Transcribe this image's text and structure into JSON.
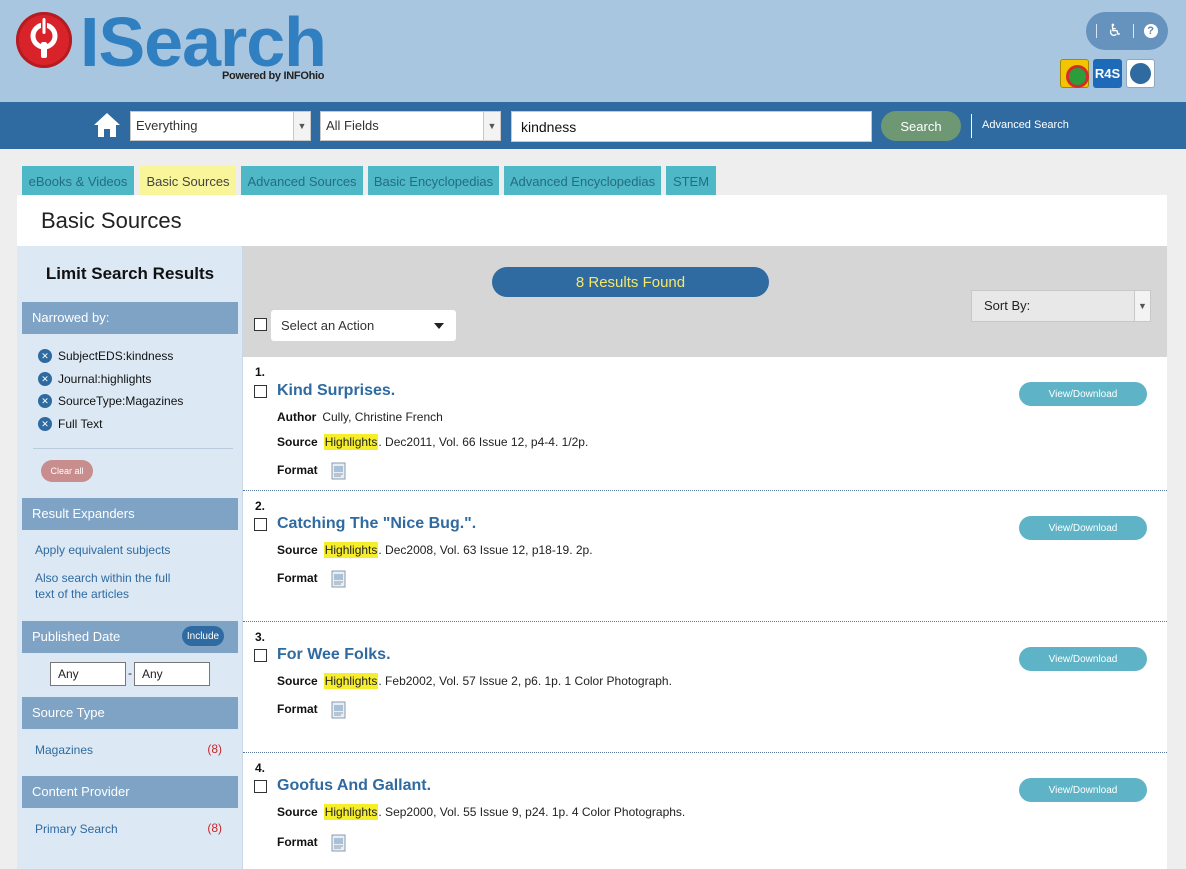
{
  "header": {
    "logo_text": "ISearch",
    "powered_by": "Powered by INFOhio",
    "help_label": "?"
  },
  "apps": {
    "app2_label": "R4S"
  },
  "search": {
    "scope": "Everything",
    "field": "All Fields",
    "query": "kindness",
    "button": "Search",
    "advanced": "Advanced Search"
  },
  "tabs": [
    {
      "label": "eBooks & Videos"
    },
    {
      "label": "Basic Sources"
    },
    {
      "label": "Advanced Sources"
    },
    {
      "label": "Basic Encyclopedias"
    },
    {
      "label": "Advanced Encyclopedias"
    },
    {
      "label": "STEM"
    }
  ],
  "page_title": "Basic Sources",
  "sidebar": {
    "title": "Limit Search Results",
    "narrowed_by": "Narrowed by:",
    "filters": [
      "SubjectEDS:kindness",
      "Journal:highlights",
      "SourceType:Magazines",
      "Full Text"
    ],
    "clear_all": "Clear all",
    "expanders_head": "Result Expanders",
    "expander1": "Apply equivalent subjects",
    "expander2a": "Also search within the full",
    "expander2b": "text of the articles",
    "published_head": "Published Date",
    "include": "Include",
    "date_from": "Any",
    "date_to": "Any",
    "date_sep": "-",
    "source_type_head": "Source Type",
    "source_type_item": "Magazines",
    "source_type_count": "(8)",
    "provider_head": "Content Provider",
    "provider_item": "Primary Search",
    "provider_count": "(8)"
  },
  "results_header": {
    "found": "8 Results Found",
    "action": "Select an Action",
    "sort": "Sort By:"
  },
  "results": [
    {
      "num": "1.",
      "title": "Kind Surprises.",
      "author_label": "Author",
      "author": "Cully, Christine French",
      "source_label": "Source",
      "journal": "Highlights",
      "details": ". Dec2011, Vol. 66 Issue 12, p4-4. 1/2p.",
      "format_label": "Format",
      "button": "View/Download"
    },
    {
      "num": "2.",
      "title": "Catching The \"Nice Bug.\".",
      "source_label": "Source",
      "journal": "Highlights",
      "details": ". Dec2008, Vol. 63 Issue 12, p18-19. 2p.",
      "format_label": "Format",
      "button": "View/Download"
    },
    {
      "num": "3.",
      "title": "For Wee Folks.",
      "source_label": "Source",
      "journal": "Highlights",
      "details": ". Feb2002, Vol. 57 Issue 2, p6. 1p. 1 Color Photograph.",
      "format_label": "Format",
      "button": "View/Download"
    },
    {
      "num": "4.",
      "title": "Goofus And Gallant.",
      "source_label": "Source",
      "journal": "Highlights",
      "details": ". Sep2000, Vol. 55 Issue 9, p24. 1p. 4 Color Photographs.",
      "format_label": "Format",
      "button": "View/Download"
    }
  ],
  "colors": {
    "header_bg": "#a9c6e0",
    "nav_bg": "#2f6aa0",
    "tab": "#4fb8c7",
    "tab_active": "#f9f59a",
    "highlight": "#f6ee2b",
    "link": "#2f6aa0"
  }
}
